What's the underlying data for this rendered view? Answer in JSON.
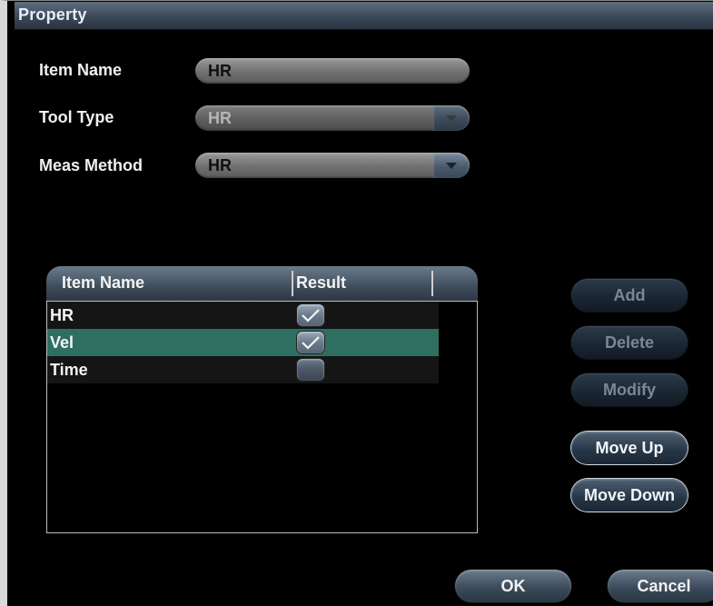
{
  "dialog": {
    "title": "Property"
  },
  "form": {
    "item_name": {
      "label": "Item Name",
      "value": "HR"
    },
    "tool_type": {
      "label": "Tool Type",
      "value": "HR"
    },
    "meas_method": {
      "label": "Meas Method",
      "value": "HR"
    }
  },
  "table": {
    "columns": [
      "Item Name",
      "Result"
    ],
    "rows": [
      {
        "name": "HR",
        "checked": true,
        "selected": false
      },
      {
        "name": "Vel",
        "checked": true,
        "selected": true
      },
      {
        "name": "Time",
        "checked": false,
        "selected": false
      }
    ]
  },
  "buttons": {
    "add": "Add",
    "delete": "Delete",
    "modify": "Modify",
    "move_up": "Move Up",
    "move_down": "Move Down",
    "ok": "OK",
    "cancel": "Cancel"
  },
  "colors": {
    "selected_row": "#2f6f62",
    "title_bar": "#3b4857"
  }
}
